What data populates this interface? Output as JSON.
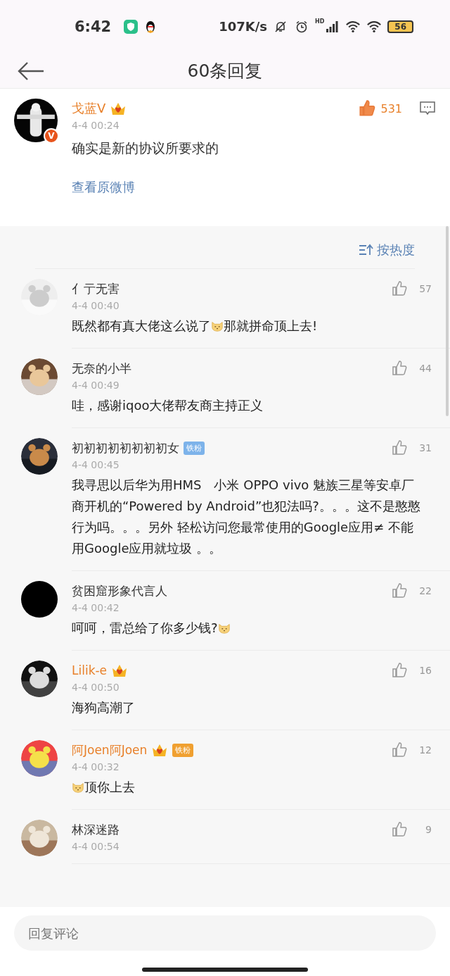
{
  "status_bar": {
    "time": "6:42",
    "speed": "107K/s",
    "signal_label": "HD",
    "battery": "56"
  },
  "header": {
    "title": "60条回复"
  },
  "post": {
    "avatar": {
      "kind": "picture"
    },
    "verified_mark": "V",
    "name": "戈蓝V",
    "vip": true,
    "time": "4-4 00:24",
    "text": "确实是新的协议所要求的",
    "likes": "531",
    "liked": true,
    "link": "查看原微博"
  },
  "sort": {
    "label": "按热度"
  },
  "comments": [
    {
      "avatar": {
        "kind": "picture"
      },
      "name": "亻亍无害",
      "vip": false,
      "time": "4-4 00:40",
      "likes": "57",
      "liked": false,
      "content": [
        {
          "kind": "text",
          "text": "既然都有真大佬这么说了"
        },
        {
          "kind": "emoji"
        },
        {
          "kind": "text",
          "text": "那就拼命顶上去!"
        }
      ]
    },
    {
      "avatar": {
        "kind": "picture"
      },
      "name": "无奈的小半",
      "vip": false,
      "time": "4-4 00:49",
      "likes": "44",
      "liked": false,
      "content": [
        {
          "kind": "text",
          "text": "哇，感谢iqoo大佬帮友商主持正义"
        }
      ]
    },
    {
      "avatar": {
        "kind": "picture"
      },
      "name": "初初初初初初初初女",
      "vip": false,
      "badge": {
        "text": "铁粉",
        "color": "#7db3ea"
      },
      "time": "4-4 00:45",
      "likes": "31",
      "liked": false,
      "content": [
        {
          "kind": "text",
          "text": "我寻思以后华为用HMS　小米 OPPO vivo 魅族三星等安卓厂商开机的“Powered by Android”也犯法吗?。。。这不是憨憨行为吗。。。另外 轻松访问您最常使用的Google应用≠ 不能用Google应用就垃圾 。。"
        }
      ]
    },
    {
      "avatar": {
        "kind": "blank"
      },
      "name": "贫困窟形象代言人",
      "vip": false,
      "time": "4-4 00:42",
      "likes": "22",
      "liked": false,
      "content": [
        {
          "kind": "text",
          "text": "呵呵，雷总给了你多少钱?"
        },
        {
          "kind": "emoji"
        }
      ]
    },
    {
      "avatar": {
        "kind": "picture"
      },
      "name": "Lilik-e",
      "vip": true,
      "time": "4-4 00:50",
      "likes": "16",
      "liked": false,
      "content": [
        {
          "kind": "text",
          "text": "海狗高潮了"
        }
      ]
    },
    {
      "avatar": {
        "kind": "picture"
      },
      "name": "阿Joen阿Joen",
      "vip": true,
      "badge": {
        "text": "铁粉",
        "color": "#f0a030"
      },
      "time": "4-4 00:32",
      "likes": "12",
      "liked": false,
      "content": [
        {
          "kind": "emoji"
        },
        {
          "kind": "text",
          "text": "顶你上去"
        }
      ]
    },
    {
      "avatar": {
        "kind": "picture"
      },
      "name": "林深迷路",
      "vip": false,
      "time": "4-4 00:54",
      "likes": "9",
      "liked": false
    }
  ],
  "reply_bar": {
    "placeholder": "回复评论"
  }
}
